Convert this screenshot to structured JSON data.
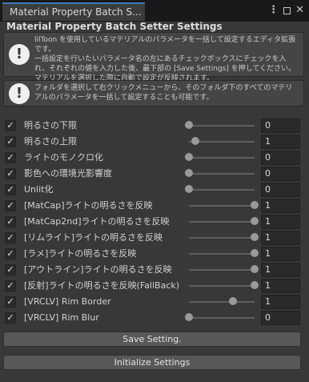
{
  "window": {
    "tab_title": "Material Property Batch S...",
    "menu_icon": "kebab-menu-icon",
    "maximize_icon": "maximize-icon",
    "close_icon": "close-icon"
  },
  "header": {
    "title": "Material Property Batch Setter Settings"
  },
  "help": [
    {
      "icon": "info-icon",
      "text": "lilToon を使用しているマテリアルのパラメータを一括して設定するエディタ拡張です。\n一括設定を行いたいパラメータ名の左にあるチェックボックスにチェックを入れ、それぞれの値を入力した後、最下部の [Save Settings] を押してください。\nマテリアルを選択した際に自動で設定が反映されます。"
    },
    {
      "icon": "info-icon",
      "text": "フォルダを選択して右クリックメニューから、そのフォルダ下のすべてのマテリアルのパラメータを一括して設定することも可能です。"
    }
  ],
  "properties": [
    {
      "label": "明るさの下限",
      "checked": true,
      "value": "0",
      "level": 0.0
    },
    {
      "label": "明るさの上限",
      "checked": true,
      "value": "1",
      "level": 0.1
    },
    {
      "label": "ライトのモノクロ化",
      "checked": true,
      "value": "0",
      "level": 0.0
    },
    {
      "label": "影色への環境光影響度",
      "checked": true,
      "value": "0",
      "level": 0.0
    },
    {
      "label": "Unlit化",
      "checked": true,
      "value": "0",
      "level": 0.0
    },
    {
      "label": "[MatCap]ライトの明るさを反映",
      "checked": true,
      "value": "1",
      "level": 1.0
    },
    {
      "label": "[MatCap2nd]ライトの明るさを反映",
      "checked": true,
      "value": "1",
      "level": 1.0
    },
    {
      "label": "[リムライト]ライトの明るさを反映",
      "checked": true,
      "value": "1",
      "level": 1.0
    },
    {
      "label": "[ラメ]ライトの明るさを反映",
      "checked": true,
      "value": "1",
      "level": 1.0
    },
    {
      "label": "[アウトライン]ライトの明るさを反映",
      "checked": true,
      "value": "1",
      "level": 1.0
    },
    {
      "label": "[反射]ライトの明るさを反映(FallBack)",
      "checked": true,
      "value": "1",
      "level": 1.0
    },
    {
      "label": "[VRCLV] Rim Border",
      "checked": true,
      "value": "1",
      "level": 0.67
    },
    {
      "label": "[VRCLV] Rim Blur",
      "checked": true,
      "value": "0",
      "level": 0.0
    }
  ],
  "buttons": {
    "save": "Save Setting.",
    "initialize": "Initialize Settings"
  },
  "colors": {
    "background": "#383838",
    "tab_accent": "#3a79bb",
    "field": "#2a2a2a",
    "button": "#585858"
  }
}
